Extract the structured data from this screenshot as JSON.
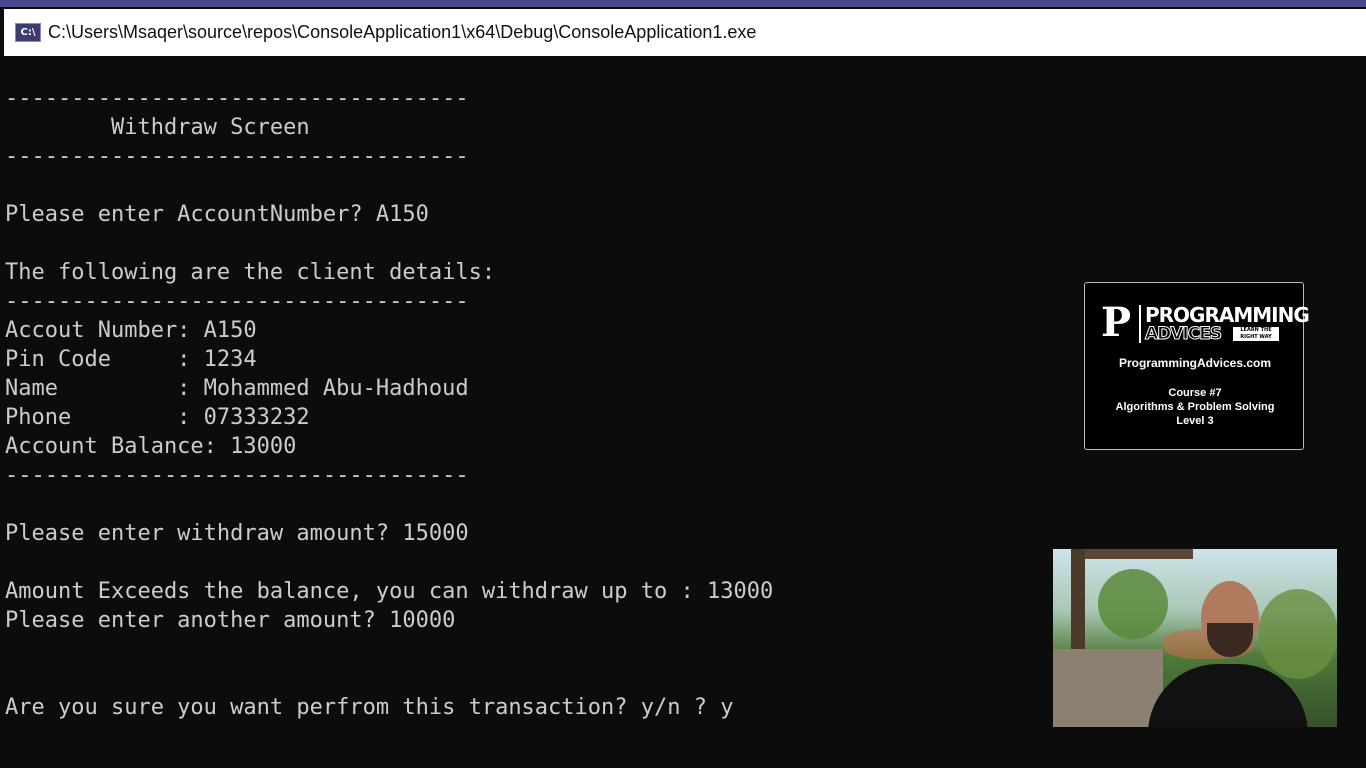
{
  "window": {
    "icon_text": "C:\\",
    "title": "C:\\Users\\Msaqer\\source\\repos\\ConsoleApplication1\\x64\\Debug\\ConsoleApplication1.exe"
  },
  "console": {
    "lines": [
      "-----------------------------------",
      "        Withdraw Screen",
      "-----------------------------------",
      "",
      "Please enter AccountNumber? A150",
      "",
      "The following are the client details:",
      "-----------------------------------",
      "Accout Number: A150",
      "Pin Code     : 1234",
      "Name         : Mohammed Abu-Hadhoud",
      "Phone        : 07333232",
      "Account Balance: 13000",
      "-----------------------------------",
      "",
      "Please enter withdraw amount? 15000",
      "",
      "Amount Exceeds the balance, you can withdraw up to : 13000",
      "Please enter another amount? 10000",
      "",
      "",
      "Are you sure you want perfrom this transaction? y/n ? y"
    ]
  },
  "promo": {
    "logo_word1": "PROGRAMMING",
    "logo_word2": "ADVICES",
    "logo_tag": "LEARN THE RIGHT WAY",
    "site": "ProgrammingAdvices.com",
    "course_line1": "Course #7",
    "course_line2": "Algorithms & Problem Solving",
    "course_line3": "Level 3"
  }
}
